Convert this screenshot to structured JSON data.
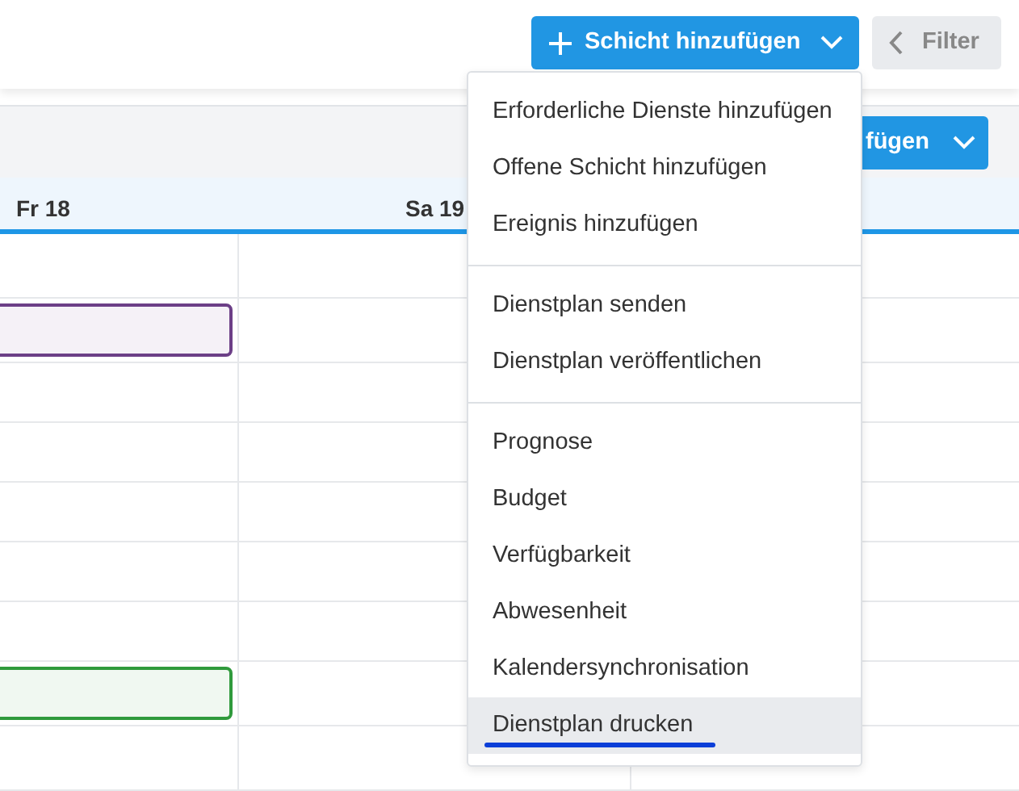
{
  "toolbar": {
    "add_shift_button": {
      "label": "Schicht hinzufügen",
      "expanded": true
    },
    "filter_button": {
      "label": "Filter"
    }
  },
  "secondary_button": {
    "label": "fügen"
  },
  "days": [
    {
      "label": "Fr 18"
    },
    {
      "label": "Sa 19"
    }
  ],
  "rows": [
    {
      "event": false
    },
    {
      "event": true,
      "color": "#6c3f87"
    },
    {
      "event": false
    },
    {
      "event": false
    },
    {
      "event": false
    },
    {
      "event": false
    },
    {
      "event": false
    },
    {
      "event": true,
      "color": "#2f9a3c"
    },
    {
      "event": false
    }
  ],
  "menu": {
    "groups": [
      {
        "items": [
          {
            "label": "Erforderliche Dienste hinzufügen",
            "selected": false,
            "underlined": false
          },
          {
            "label": "Offene Schicht hinzufügen",
            "selected": false,
            "underlined": false
          },
          {
            "label": "Ereignis hinzufügen",
            "selected": false,
            "underlined": false
          }
        ]
      },
      {
        "items": [
          {
            "label": "Dienstplan senden",
            "selected": false,
            "underlined": false
          },
          {
            "label": "Dienstplan veröffentlichen",
            "selected": false,
            "underlined": false
          }
        ]
      },
      {
        "items": [
          {
            "label": "Prognose",
            "selected": false,
            "underlined": false
          },
          {
            "label": "Budget",
            "selected": false,
            "underlined": false
          },
          {
            "label": "Verfügbarkeit",
            "selected": false,
            "underlined": false
          },
          {
            "label": "Abwesenheit",
            "selected": false,
            "underlined": false
          },
          {
            "label": "Kalendersynchronisation",
            "selected": false,
            "underlined": false
          },
          {
            "label": "Dienstplan drucken",
            "selected": true,
            "underlined": true
          }
        ]
      }
    ]
  }
}
